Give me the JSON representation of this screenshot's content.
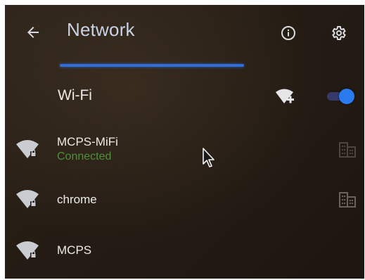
{
  "header": {
    "back_icon": "arrow-left-icon",
    "title": "Network",
    "info_icon": "info-icon",
    "settings_icon": "gear-icon"
  },
  "progress": {
    "state": "scanning",
    "color": "#2f6ed8"
  },
  "wifi": {
    "label": "Wi-Fi",
    "add_network_icon": "wifi-add-icon",
    "enabled": true,
    "toggle_color": "#2a7af0"
  },
  "networks": [
    {
      "name": "MCPS-MiFi",
      "status": "Connected",
      "icon": "wifi-secure-icon",
      "action_icon": "enterprise-building-icon",
      "status_color": "#4f8f3a"
    },
    {
      "name": "chrome",
      "status": "",
      "icon": "wifi-secure-icon",
      "action_icon": "enterprise-building-icon"
    },
    {
      "name": "MCPS",
      "status": "",
      "icon": "wifi-secure-icon"
    }
  ],
  "colors": {
    "accent": "#2f6ed8",
    "title": "#c9d2e6",
    "connected": "#4f8f3a"
  }
}
